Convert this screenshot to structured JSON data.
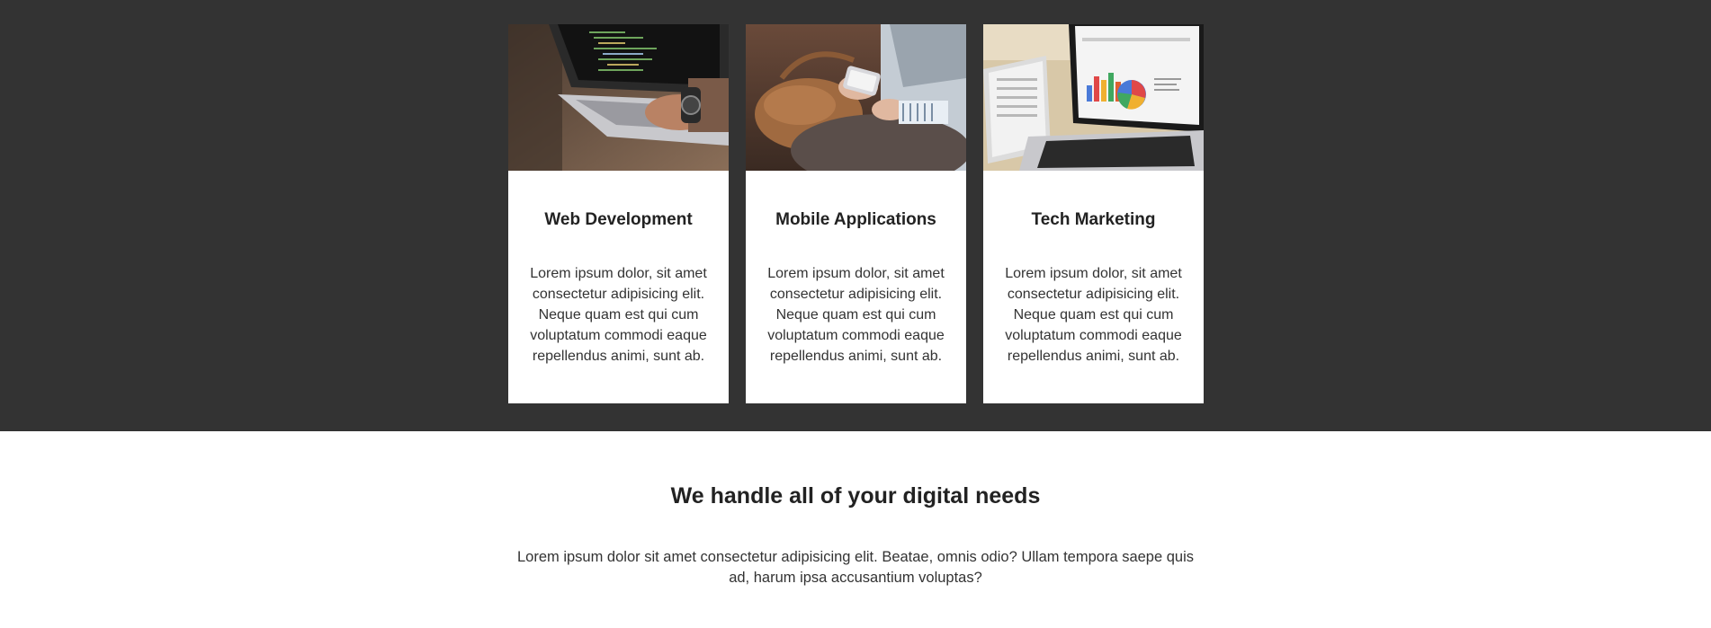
{
  "services": {
    "cards": [
      {
        "title": "Web Development",
        "body": "Lorem ipsum dolor, sit amet consectetur adipisicing elit. Neque quam est qui cum voluptatum commodi eaque repellendus animi, sunt ab."
      },
      {
        "title": "Mobile Applications",
        "body": "Lorem ipsum dolor, sit amet consectetur adipisicing elit. Neque quam est qui cum voluptatum commodi eaque repellendus animi, sunt ab."
      },
      {
        "title": "Tech Marketing",
        "body": "Lorem ipsum dolor, sit amet consectetur adipisicing elit. Neque quam est qui cum voluptatum commodi eaque repellendus animi, sunt ab."
      }
    ]
  },
  "intro": {
    "title": "We handle all of your digital needs",
    "text": "Lorem ipsum dolor sit amet consectetur adipisicing elit. Beatae, omnis odio? Ullam tempora saepe quis ad, harum ipsa accusantium voluptas?"
  },
  "colors": {
    "dark_section": "#333333",
    "card_background": "#ffffff",
    "heading": "#222222",
    "text": "#333333"
  },
  "images": [
    "laptop-coding-photo",
    "phone-and-bag-photo",
    "laptop-charts-photo"
  ]
}
